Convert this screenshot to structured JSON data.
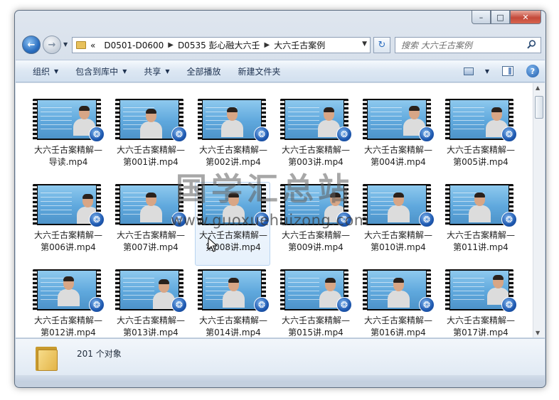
{
  "window": {
    "caption_buttons": {
      "minimize": "–",
      "maximize": "□",
      "close": "✕"
    }
  },
  "navigation": {
    "back_label": "←",
    "forward_label": "→",
    "breadcrumb_prefix": "«",
    "breadcrumbs": [
      "D0501-D0600",
      "D0535 彭心融大六壬",
      "大六壬古案例"
    ],
    "refresh_label": "↻",
    "search_placeholder": "搜索 大六壬古案例"
  },
  "toolbar": {
    "items": [
      {
        "label": "组织",
        "dropdown": true
      },
      {
        "label": "包含到库中",
        "dropdown": true
      },
      {
        "label": "共享",
        "dropdown": true
      },
      {
        "label": "全部播放",
        "dropdown": false
      },
      {
        "label": "新建文件夹",
        "dropdown": false
      }
    ],
    "help_label": "?"
  },
  "files": [
    {
      "name": "大六壬古案精解—导读.mp4"
    },
    {
      "name": "大六壬古案精解—第001讲.mp4"
    },
    {
      "name": "大六壬古案精解—第002讲.mp4"
    },
    {
      "name": "大六壬古案精解—第003讲.mp4"
    },
    {
      "name": "大六壬古案精解—第004讲.mp4"
    },
    {
      "name": "大六壬古案精解—第005讲.mp4"
    },
    {
      "name": "大六壬古案精解—第006讲.mp4"
    },
    {
      "name": "大六壬古案精解—第007讲.mp4"
    },
    {
      "name": "大六壬古案精解—第008讲.mp4"
    },
    {
      "name": "大六壬古案精解—第009讲.mp4"
    },
    {
      "name": "大六壬古案精解—第010讲.mp4"
    },
    {
      "name": "大六壬古案精解—第011讲.mp4"
    },
    {
      "name": "大六壬古案精解—第012讲.mp4"
    },
    {
      "name": "大六壬古案精解—第013讲.mp4"
    },
    {
      "name": "大六壬古案精解—第014讲.mp4"
    },
    {
      "name": "大六壬古案精解—第015讲.mp4"
    },
    {
      "name": "大六壬古案精解—第016讲.mp4"
    },
    {
      "name": "大六壬古案精解—第017讲.mp4"
    }
  ],
  "details": {
    "object_count": "201 个对象"
  },
  "watermark": {
    "title": "国学汇总站",
    "url": "www.guoxuehuizong.com"
  },
  "colors": {
    "accent": "#1d58b0",
    "thumb_sky": "#5fa8dd"
  },
  "icons": {
    "media_badge": "media-player-icon",
    "folder": "folder-icon"
  }
}
